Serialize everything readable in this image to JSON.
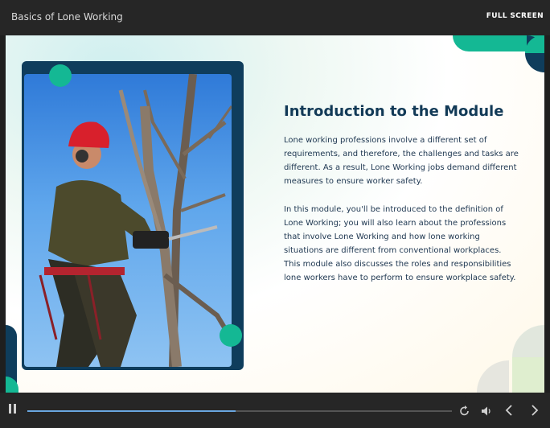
{
  "header": {
    "course_title": "Basics of Lone Working",
    "fullscreen_label": "FULL SCREEN"
  },
  "slide": {
    "title": "Introduction to the Module",
    "paragraph1": "Lone working professions involve a different set of requirements, and therefore, the challenges and tasks are different. As a result, Lone Working jobs demand different measures to ensure worker safety.",
    "paragraph2": "In this module, you'll be introduced to the definition of Lone Working; you will also learn about the professions that involve Lone Working and how lone working situations are different from conventional workplaces. This module also discusses the roles and responsibilities lone workers have to perform to ensure workplace safety.",
    "image_subject": "arborist-with-chainsaw",
    "colors": {
      "accent_teal": "#14b894",
      "frame_navy": "#0f3d5c",
      "title": "#123a57"
    }
  },
  "player": {
    "progress": 0.49,
    "icons": [
      "pause-icon",
      "replay-icon",
      "volume-icon",
      "previous-icon",
      "next-icon"
    ]
  }
}
